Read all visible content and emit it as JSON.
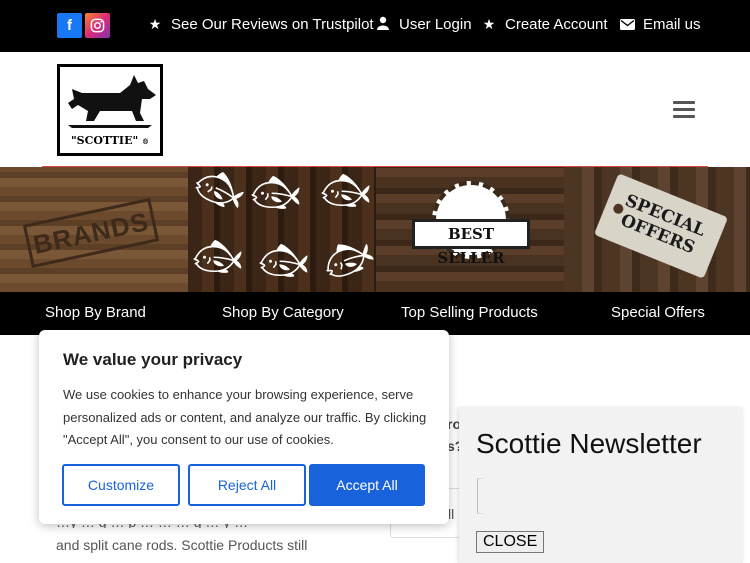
{
  "topbar": {
    "facebook_icon": "facebook-icon",
    "instagram_icon": "instagram-icon",
    "links": [
      {
        "icon": "star-icon",
        "label": "See Our Reviews on Trustpilot"
      },
      {
        "icon": "user-icon",
        "label": "User Login"
      },
      {
        "icon": "star-icon",
        "label": "Create Account"
      },
      {
        "icon": "envelope-icon",
        "label": "Email us"
      }
    ]
  },
  "header": {
    "logo_text": "\"SCOTTIE\"",
    "logo_mark": "®",
    "menu_icon": "hamburger-icon"
  },
  "tiles": {
    "brands_label": "BRANDS",
    "best_seller_label": "BEST SELLER",
    "special_offers_label": "SPECIAL OFFERS"
  },
  "category_nav": [
    {
      "label": "Shop By Brand"
    },
    {
      "label": "Shop By Category"
    },
    {
      "label": "Top Selling Products"
    },
    {
      "label": "Special Offers"
    }
  ],
  "content": {
    "partial_line": "…y … g … p … … … g … y …",
    "line": "and  split cane rods.  Scottie Products still",
    "side_fragment_1": "ro",
    "side_fragment_2": "s?",
    "side_fragment_3": "ll"
  },
  "cookie_banner": {
    "title": "We value your privacy",
    "body": "We use cookies to enhance your browsing experience, serve personalized ads or content, and analyze our traffic. By clicking \"Accept All\", you consent to our use of cookies.",
    "customize_label": "Customize",
    "reject_label": "Reject All",
    "accept_label": "Accept All",
    "accent_color": "#1863dc"
  },
  "newsletter": {
    "title": "Scottie Newsletter",
    "close_label": "CLOSE"
  }
}
